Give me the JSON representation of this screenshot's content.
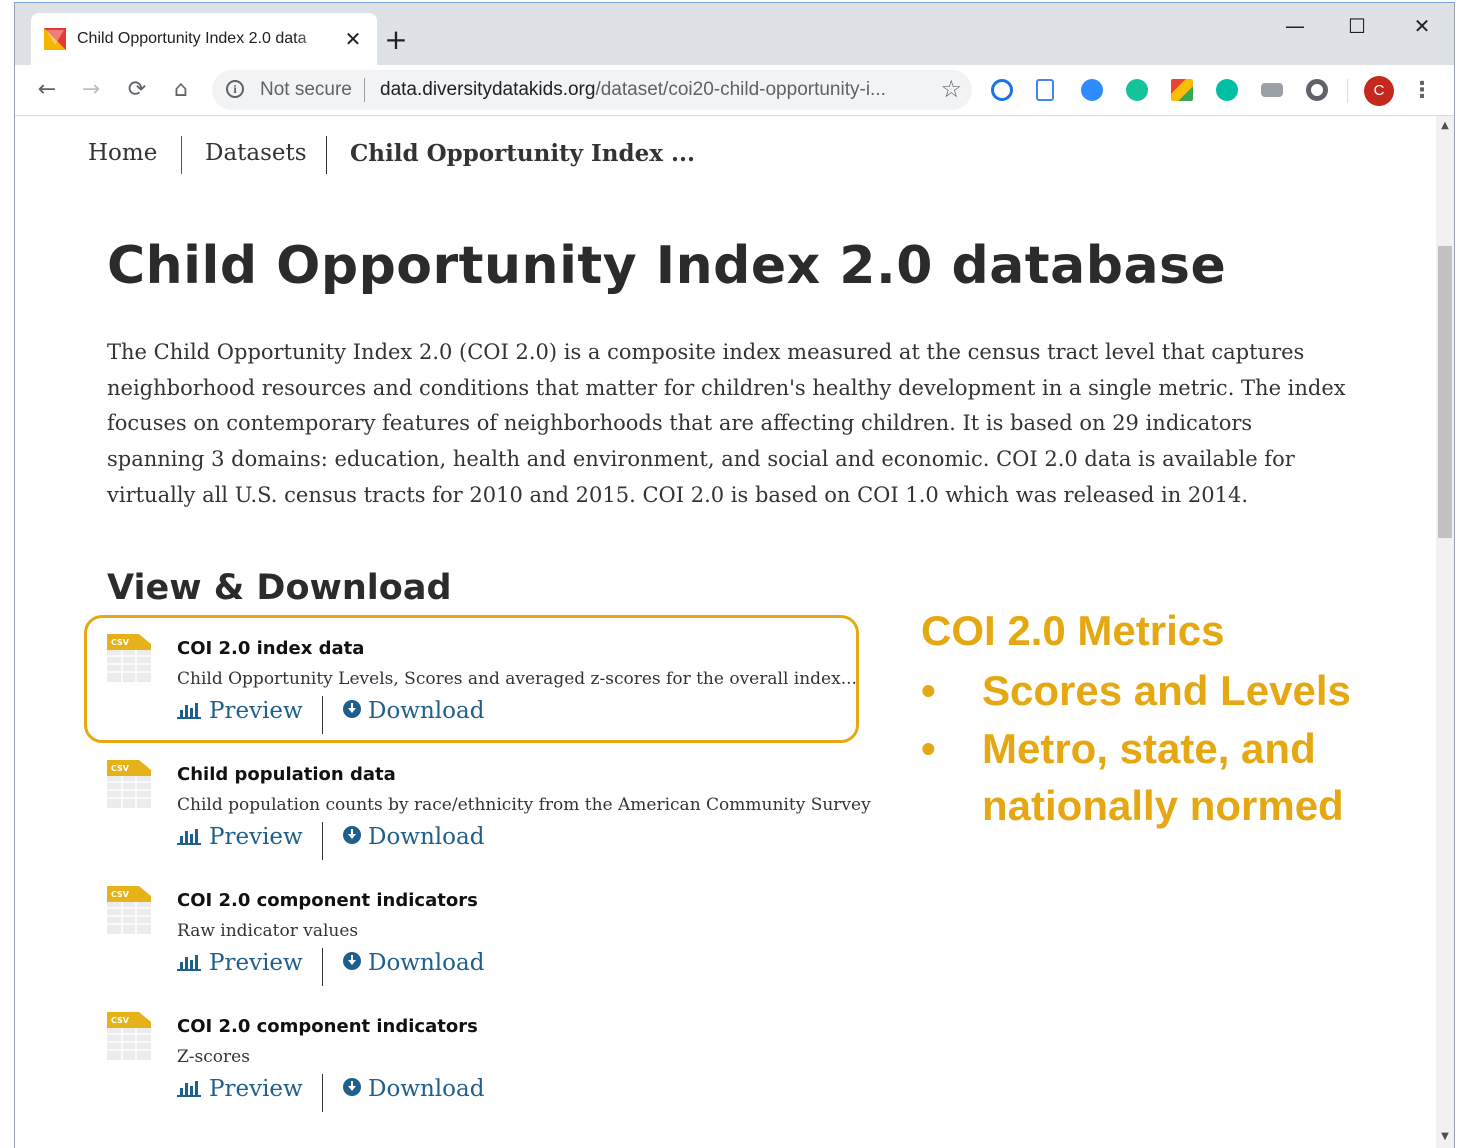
{
  "browser": {
    "tab_title": "Child Opportunity Index 2.0 data",
    "tab_close": "✕",
    "new_tab": "+",
    "window_controls": {
      "minimize": "—",
      "maximize": "☐",
      "close": "✕"
    },
    "not_secure_label": "Not secure",
    "url_host": "data.diversitydatakids.org",
    "url_path": "/dataset/coi20-child-opportunity-i...",
    "avatar_letter": "C",
    "extensions": [
      {
        "name": "lock-extension-icon",
        "color": "#1a73e8"
      },
      {
        "name": "docs-extension-icon",
        "color": "#4285f4"
      },
      {
        "name": "zoom-extension-icon",
        "color": "#2d8cff"
      },
      {
        "name": "grammarly-extension-icon",
        "color": "#15c39a"
      },
      {
        "name": "google-extension-icon",
        "color": "#fbbc05"
      },
      {
        "name": "m-extension-icon",
        "color": "#00bfa5"
      },
      {
        "name": "screenshot-extension-icon",
        "color": "#9aa0a6"
      },
      {
        "name": "circle-extension-icon",
        "color": "#5f6368"
      }
    ]
  },
  "breadcrumb": {
    "home": "Home",
    "datasets": "Datasets",
    "current": "Child Opportunity Index ..."
  },
  "page": {
    "title": "Child Opportunity Index 2.0 database",
    "description": "The Child Opportunity Index 2.0 (COI 2.0) is a composite index measured at the census tract level that captures neighborhood resources and conditions that matter for children's healthy development in a single metric. The index focuses on contemporary features of neighborhoods that are affecting children. It is based on 29 indicators spanning 3 domains: education, health and environment, and social and economic. COI 2.0 data is available for virtually all U.S. census tracts for 2010 and 2015. COI 2.0 is based on COI 1.0 which was released in 2014.",
    "section_title": "View & Download"
  },
  "resources": [
    {
      "icon_label": "CSV",
      "title": "COI 2.0 index data",
      "description": "Child Opportunity Levels, Scores and averaged z-scores for the overall index...",
      "preview": "Preview",
      "download": "Download"
    },
    {
      "icon_label": "CSV",
      "title": "Child population data",
      "description": "Child population counts by race/ethnicity from the American Community Survey",
      "preview": "Preview",
      "download": "Download"
    },
    {
      "icon_label": "CSV",
      "title": "COI 2.0 component indicators",
      "description": "Raw indicator values",
      "preview": "Preview",
      "download": "Download"
    },
    {
      "icon_label": "CSV",
      "title": "COI 2.0 component indicators",
      "description": "Z-scores",
      "preview": "Preview",
      "download": "Download"
    }
  ],
  "annotation": {
    "title": "COI 2.0 Metrics",
    "bullet": "•",
    "items": [
      "Scores and Levels",
      "Metro, state, and",
      "nationally normed"
    ],
    "color": "#e5a812"
  }
}
